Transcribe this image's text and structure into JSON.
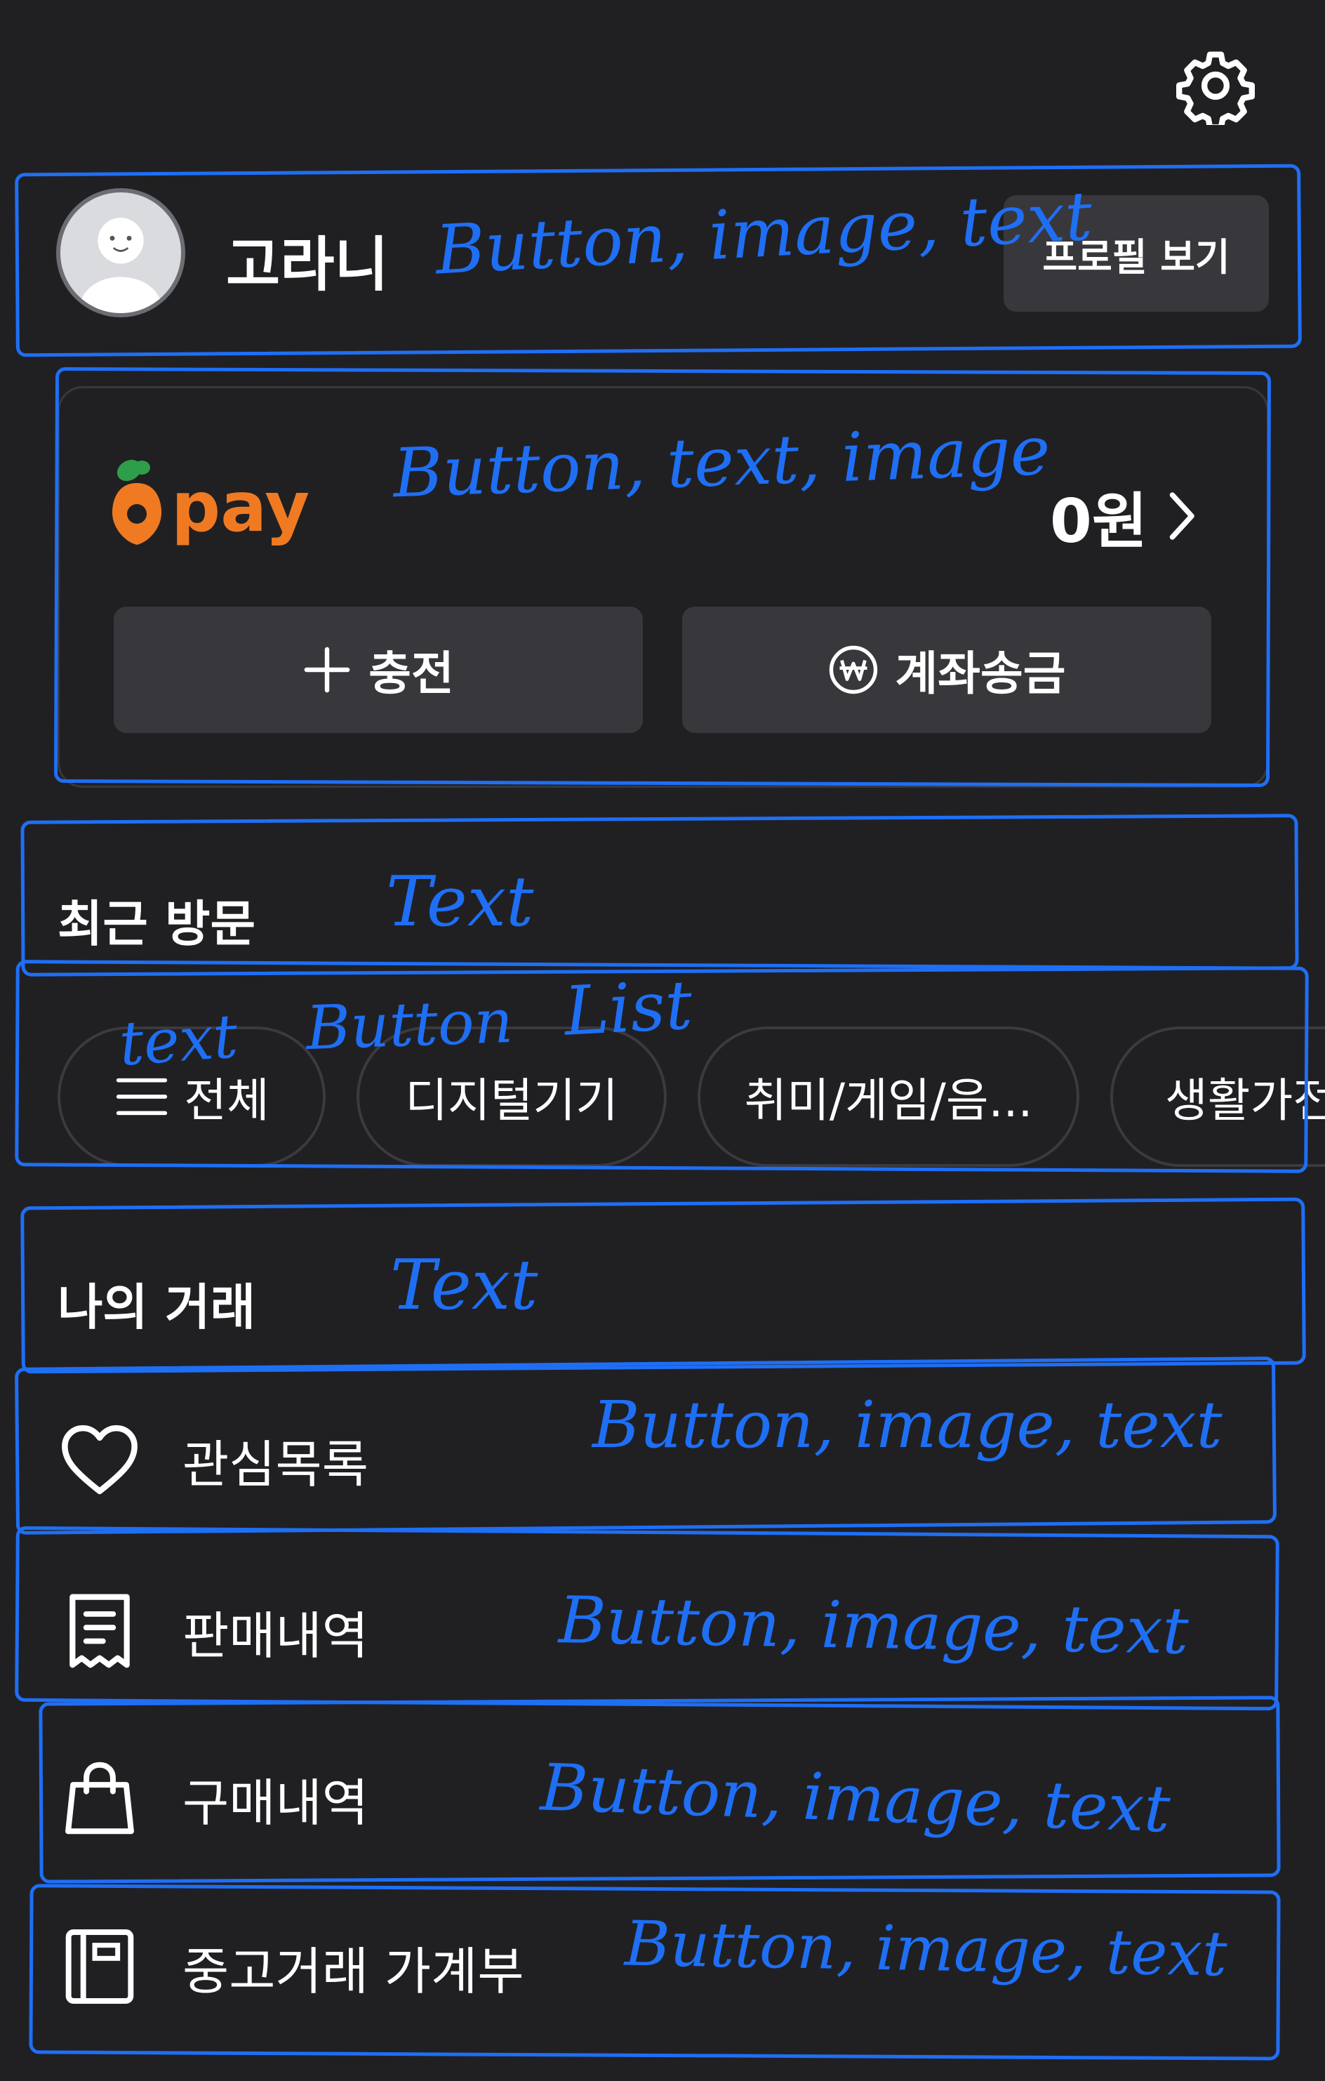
{
  "header": {
    "settings_icon": "gear-icon"
  },
  "profile": {
    "avatar_icon": "avatar",
    "username": "고라니",
    "profile_button_label": "프로필 보기",
    "annotation": "Button, image, text"
  },
  "pay": {
    "brand": "pay",
    "balance": "0원",
    "annotation": "Button, text, image",
    "charge_label": "충전",
    "transfer_label": "계좌송금",
    "brand_color": "#f07a22",
    "leaf_color": "#2e9e4a"
  },
  "recent_visits": {
    "title": "최근 방문",
    "title_annotation": "Text",
    "annotations": {
      "text": "text",
      "button": "Button",
      "list": "List"
    },
    "chips": [
      {
        "label": "전체"
      },
      {
        "label": "디지털기기"
      },
      {
        "label": "취미/게임/음..."
      },
      {
        "label": "생활가전"
      }
    ]
  },
  "my_trades": {
    "title": "나의 거래",
    "title_annotation": "Text",
    "items": [
      {
        "label": "관심목록",
        "icon": "heart-icon",
        "annotation": "Button, image, text"
      },
      {
        "label": "판매내역",
        "icon": "receipt-icon",
        "annotation": "Button, image, text"
      },
      {
        "label": "구매내역",
        "icon": "shopping-bag-icon",
        "annotation": "Button, image, text"
      },
      {
        "label": "중고거래 가계부",
        "icon": "ledger-book-icon",
        "annotation": "Button, image, text"
      }
    ]
  },
  "colors": {
    "background": "#202023",
    "surface": "#38383c",
    "annotation": "#1f6ff5"
  }
}
